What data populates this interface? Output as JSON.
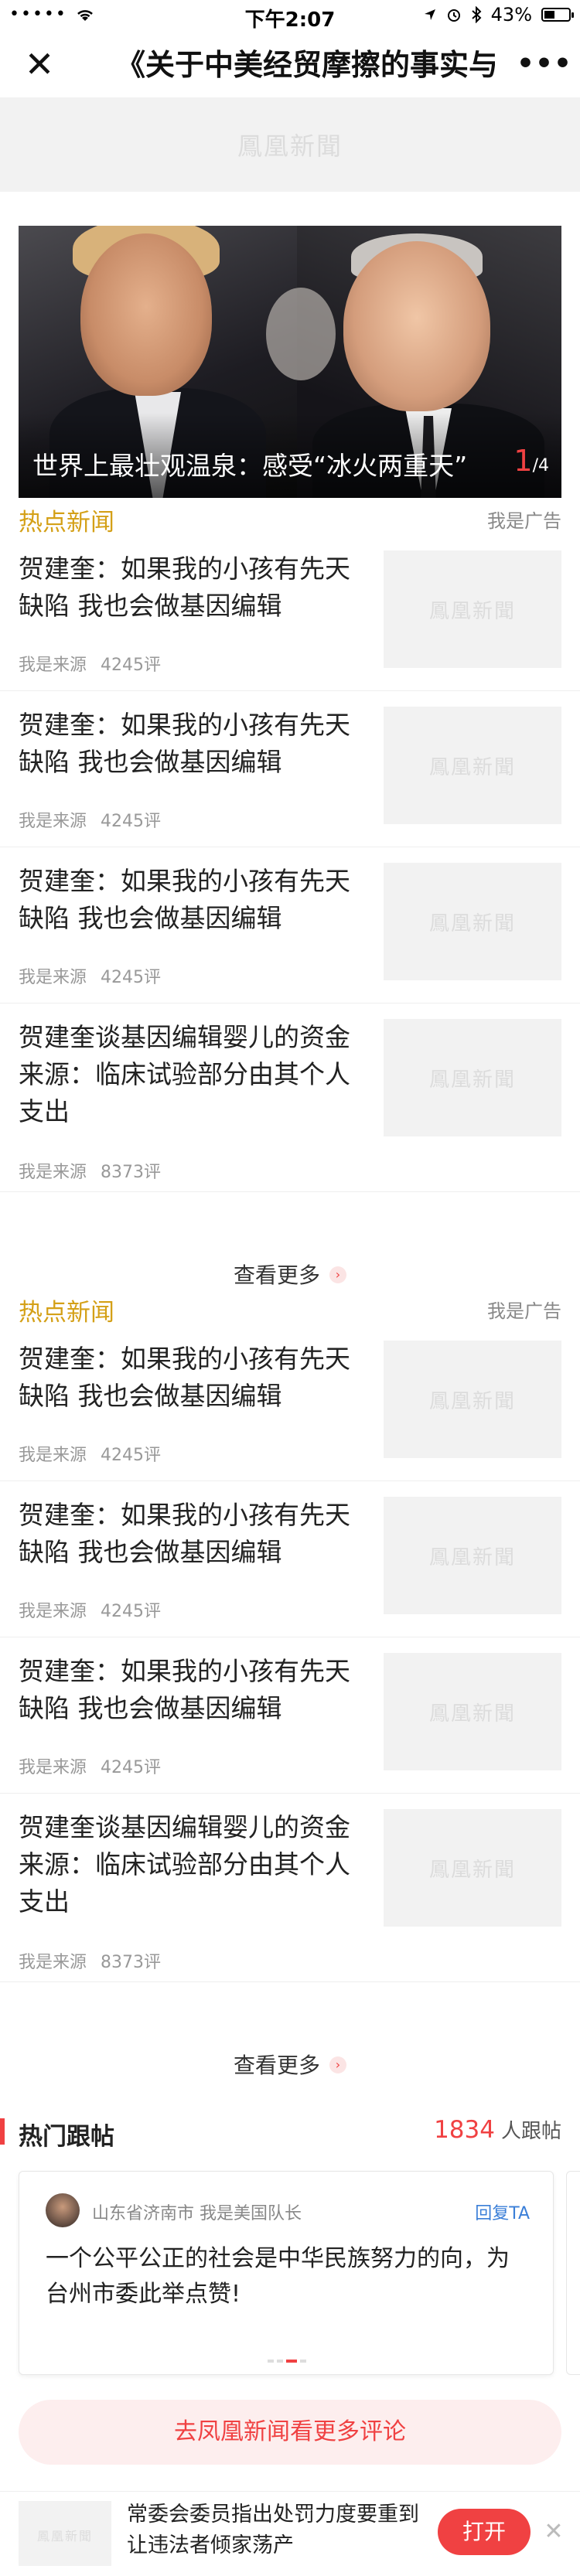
{
  "status_bar": {
    "signal": "•••••",
    "wifi_icon": "wifi-icon",
    "time": "下午2:07",
    "battery_percent": "43%",
    "battery_level": 0.43
  },
  "nav": {
    "title": "《关于中美经贸摩擦的事实与"
  },
  "placeholder_logo": "鳳凰新聞",
  "hero": {
    "caption": "世界上最壮观温泉：感受“冰火两重天”",
    "current": "1",
    "separator": "/",
    "total": "4"
  },
  "sections": [
    {
      "title": "热点新闻",
      "tag": "我是广告",
      "items": [
        {
          "title": "贺建奎：如果我的小孩有先天缺陷 我也会做基因编辑",
          "source": "我是来源",
          "comments": "4245评"
        },
        {
          "title": "贺建奎：如果我的小孩有先天缺陷 我也会做基因编辑",
          "source": "我是来源",
          "comments": "4245评"
        },
        {
          "title": "贺建奎：如果我的小孩有先天缺陷 我也会做基因编辑",
          "source": "我是来源",
          "comments": "4245评"
        },
        {
          "title": "贺建奎谈基因编辑婴儿的资金来源：临床试验部分由其个人支出",
          "source": "我是来源",
          "comments": "8373评"
        }
      ],
      "see_more": "查看更多"
    },
    {
      "title": "热点新闻",
      "tag": "我是广告",
      "items": [
        {
          "title": "贺建奎：如果我的小孩有先天缺陷 我也会做基因编辑",
          "source": "我是来源",
          "comments": "4245评"
        },
        {
          "title": "贺建奎：如果我的小孩有先天缺陷 我也会做基因编辑",
          "source": "我是来源",
          "comments": "4245评"
        },
        {
          "title": "贺建奎：如果我的小孩有先天缺陷 我也会做基因编辑",
          "source": "我是来源",
          "comments": "4245评"
        },
        {
          "title": "贺建奎谈基因编辑婴儿的资金来源：临床试验部分由其个人支出",
          "source": "我是来源",
          "comments": "8373评"
        }
      ],
      "see_more": "查看更多"
    }
  ],
  "hot_comments": {
    "title": "热门跟帖",
    "count": "1834",
    "count_suffix": "人跟帖",
    "comment": {
      "author": "山东省济南市 我是美国队长",
      "reply": "回复TA",
      "text": "一个公平公正的社会是中华民族努力的向，为台州市委此举点赞!"
    },
    "more_button": "去凤凰新闻看更多评论"
  },
  "promo": {
    "text": "常委会委员指出处罚力度要重到让违法者倾家荡产",
    "open_button": "打开"
  },
  "colors": {
    "accent_red": "#f04142",
    "section_gold": "#d4a017",
    "link_blue": "#3b7fd8"
  }
}
